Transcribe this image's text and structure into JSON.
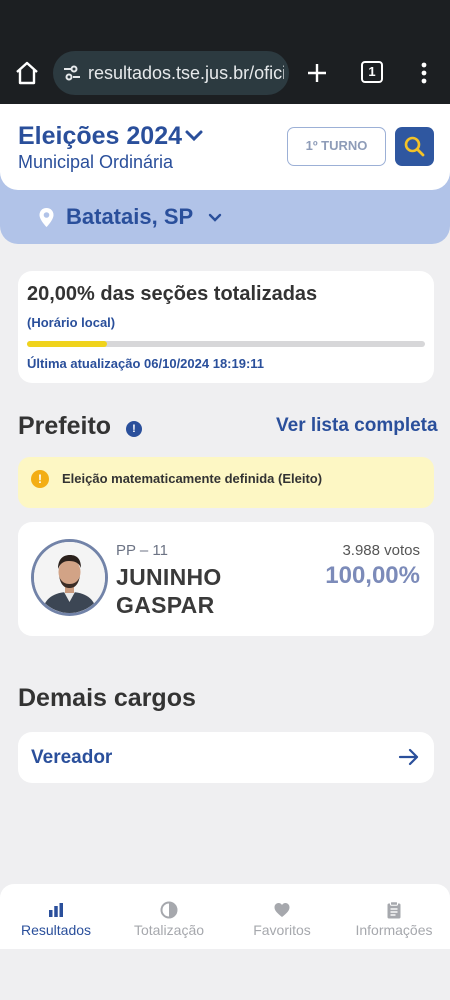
{
  "browser": {
    "url": "resultados.tse.jus.br/oficial",
    "tab_count": "1"
  },
  "header": {
    "title": "Eleições 2024",
    "subtitle": "Municipal Ordinária",
    "turno_label": "1º TURNO"
  },
  "location": {
    "label": "Batatais, SP"
  },
  "progress": {
    "title": "20,00% das seções totalizadas",
    "local_note": "(Horário local)",
    "percent": 20,
    "updated": "Última atualização 06/10/2024 18:19:11"
  },
  "prefeito": {
    "title": "Prefeito",
    "info": "!",
    "see_all": "Ver lista completa",
    "alert": "Eleição matematicamente definida (Eleito)",
    "candidate": {
      "party": "PP – 11",
      "name": "JUNINHO GASPAR",
      "votes": "3.988 votos",
      "percent": "100,00%"
    }
  },
  "demais": {
    "title": "Demais cargos",
    "items": [
      {
        "label": "Vereador"
      }
    ]
  },
  "nav": {
    "items": [
      {
        "label": "Resultados",
        "icon": "bar-chart-icon"
      },
      {
        "label": "Totalização",
        "icon": "pie-chart-icon"
      },
      {
        "label": "Favoritos",
        "icon": "heart-icon"
      },
      {
        "label": "Informações",
        "icon": "clipboard-icon"
      }
    ]
  },
  "colors": {
    "primary": "#2a4f9b",
    "accent_yellow": "#f0d31c",
    "alert_bg": "#fdf7c4",
    "subheader": "#b1c3e8"
  }
}
